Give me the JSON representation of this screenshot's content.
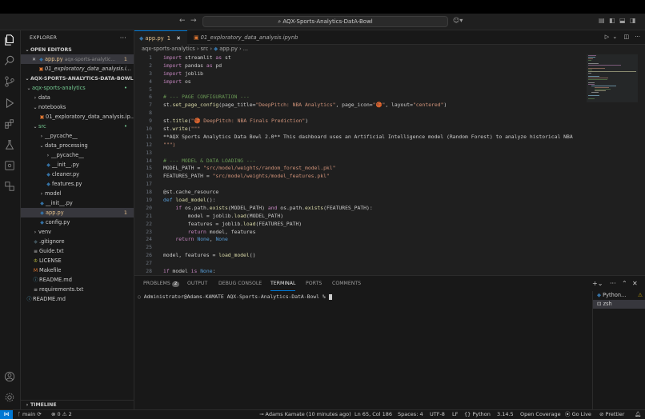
{
  "window": {
    "command_center": "AQX-Sports-Analytics-DatA-Bowl"
  },
  "explorer": {
    "title": "EXPLORER",
    "open_editors_label": "OPEN EDITORS",
    "open_editors": [
      {
        "name": "app.py",
        "path": "aqx-sports-analytic...",
        "badge": "1"
      },
      {
        "name": "01_exploratory_data_analysis.i..."
      }
    ],
    "workspace_label": "AQX-SPORTS-ANALYTICS-DATA-BOWL",
    "tree": [
      {
        "name": "aqx-sports-analytics",
        "indent": 0,
        "kind": "folder-open",
        "dot": true
      },
      {
        "name": "data",
        "indent": 1,
        "kind": "folder"
      },
      {
        "name": "notebooks",
        "indent": 1,
        "kind": "folder-open"
      },
      {
        "name": "01_exploratory_data_analysis.ip...",
        "indent": 2,
        "kind": "file"
      },
      {
        "name": "src",
        "indent": 1,
        "kind": "folder-open",
        "dot": true
      },
      {
        "name": "__pycache__",
        "indent": 2,
        "kind": "folder"
      },
      {
        "name": "data_processing",
        "indent": 2,
        "kind": "folder-open"
      },
      {
        "name": "__pycache__",
        "indent": 3,
        "kind": "folder"
      },
      {
        "name": "__init__.py",
        "indent": 3,
        "kind": "py"
      },
      {
        "name": "cleaner.py",
        "indent": 3,
        "kind": "py"
      },
      {
        "name": "features.py",
        "indent": 3,
        "kind": "py"
      },
      {
        "name": "model",
        "indent": 2,
        "kind": "folder"
      },
      {
        "name": "__init__.py",
        "indent": 2,
        "kind": "py"
      },
      {
        "name": "app.py",
        "indent": 2,
        "kind": "py",
        "selected": true,
        "badge": "1"
      },
      {
        "name": "config.py",
        "indent": 2,
        "kind": "py"
      },
      {
        "name": "venv",
        "indent": 1,
        "kind": "folder"
      },
      {
        "name": ".gitignore",
        "indent": 1,
        "kind": "git"
      },
      {
        "name": "Guide.txt",
        "indent": 1,
        "kind": "txt"
      },
      {
        "name": "LICENSE",
        "indent": 1,
        "kind": "license"
      },
      {
        "name": "Makefile",
        "indent": 1,
        "kind": "make"
      },
      {
        "name": "README.md",
        "indent": 1,
        "kind": "md"
      },
      {
        "name": "requirements.txt",
        "indent": 1,
        "kind": "txt"
      },
      {
        "name": "README.md",
        "indent": 0,
        "kind": "md"
      }
    ],
    "timeline_label": "TIMELINE"
  },
  "editor": {
    "tabs": [
      {
        "name": "app.py",
        "badge": "1"
      },
      {
        "name": "01_exploratory_data_analysis.ipynb"
      }
    ],
    "breadcrumb": [
      "aqx-sports-analytics",
      "src",
      "app.py",
      "..."
    ],
    "lines": [
      "import streamlit as st",
      "import pandas as pd",
      "import joblib",
      "import os",
      "",
      "# --- PAGE CONFIGURATION ---",
      "st.set_page_config(page_title=\"DeepPitch: NBA Analytics\", page_icon=\"🏀\", layout=\"centered\")",
      "",
      "st.title(\"🏀 DeepPitch: NBA Finals Prediction\")",
      "st.write(\"\"\"",
      "**AQX Sports Analytics Data Bowl 2.0** This dashboard uses an Artificial Intelligence model (Random Forest) to analyze historical NBA",
      "\"\"\")",
      "",
      "# --- MODEL & DATA LOADING ---",
      "MODEL_PATH = \"src/model/weights/random_forest_model.pkl\"",
      "FEATURES_PATH = \"src/model/weights/model_features.pkl\"",
      "",
      "@st.cache_resource",
      "def load_model():",
      "    if os.path.exists(MODEL_PATH) and os.path.exists(FEATURES_PATH):",
      "        model = joblib.load(MODEL_PATH)",
      "        features = joblib.load(FEATURES_PATH)",
      "        return model, features",
      "    return None, None",
      "",
      "model, features = load_model()",
      "",
      "if model is None:"
    ]
  },
  "panel": {
    "tabs": [
      "PROBLEMS",
      "OUTPUT",
      "DEBUG CONSOLE",
      "TERMINAL",
      "PORTS",
      "COMMENTS"
    ],
    "problems_count": "2",
    "active_tab": "TERMINAL",
    "terminal_prompt": "Administrator@Adams-KAMATE AQX-Sports-Analytics-DatA-Bowl %",
    "terminals": [
      "Python...",
      "zsh"
    ]
  },
  "status": {
    "branch": "main",
    "errors": "0",
    "warnings": "2",
    "blame": "Adams Kamate (10 minutes ago)",
    "position": "Ln 65, Col 186",
    "spaces": "Spaces: 4",
    "encoding": "UTF-8",
    "eol": "LF",
    "language": "Python",
    "python_version": "3.14.5",
    "coverage": "Open Coverage",
    "golive": "Go Live",
    "prettier": "Prettier"
  },
  "colors": {
    "accent": "#0078d4",
    "modified": "#e2c08d",
    "untracked": "#73c991"
  }
}
